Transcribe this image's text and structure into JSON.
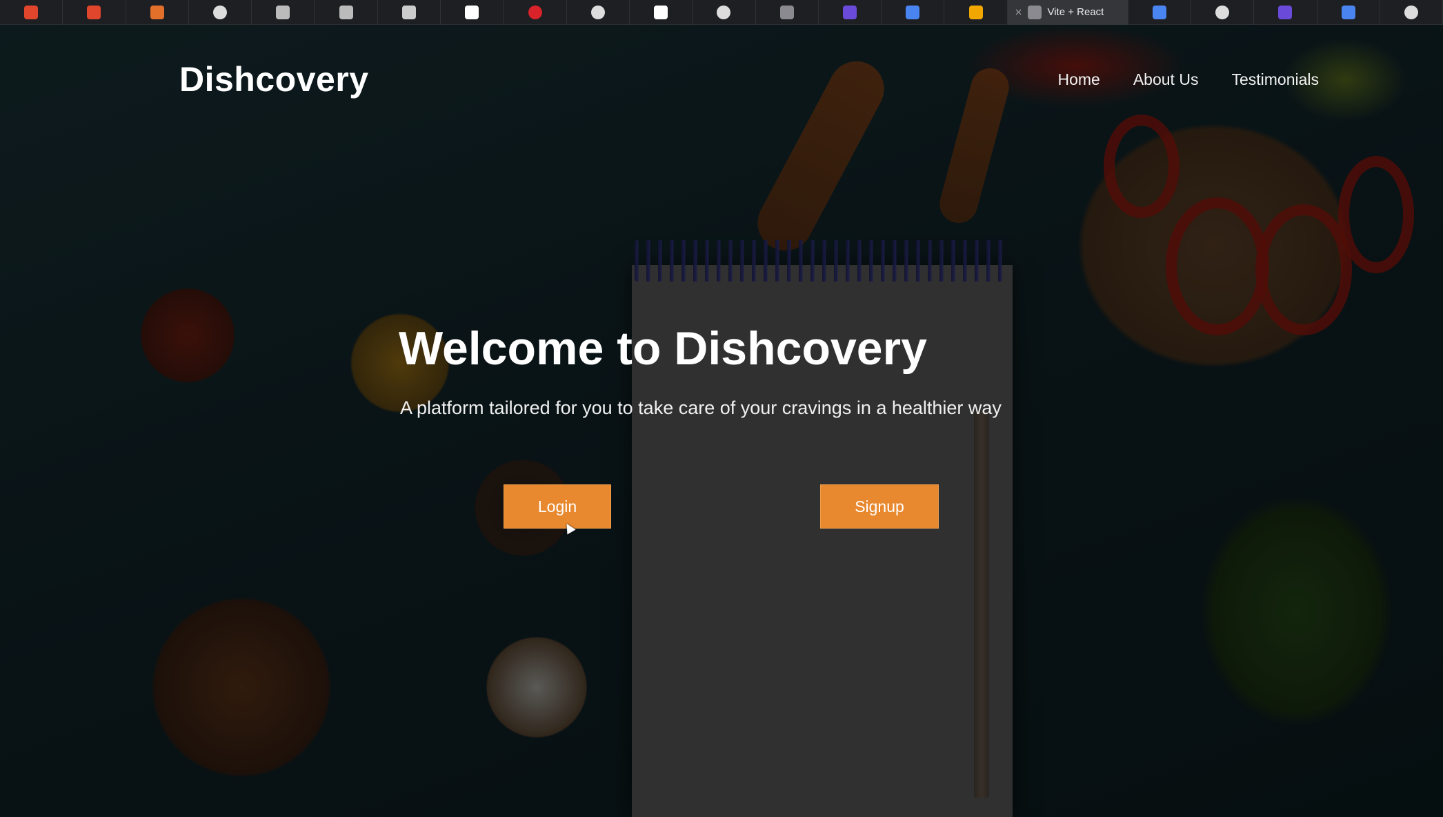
{
  "browser": {
    "tabs": [
      {
        "icon": "red-app-icon",
        "color": "#e0462c"
      },
      {
        "icon": "red-app-icon",
        "color": "#e0462c"
      },
      {
        "icon": "orange-app-icon",
        "color": "#e2702a"
      },
      {
        "icon": "chrome-icon",
        "color": "#dddddd"
      },
      {
        "icon": "github-copilot-icon",
        "color": "#bbbbbb"
      },
      {
        "icon": "github-copilot-icon",
        "color": "#bbbbbb"
      },
      {
        "icon": "openai-icon",
        "color": "#cccccc"
      },
      {
        "icon": "github-icon",
        "color": "#ffffff"
      },
      {
        "icon": "red-circle-icon",
        "color": "#d8232a"
      },
      {
        "icon": "chrome-icon",
        "color": "#dddddd"
      },
      {
        "icon": "notion-icon",
        "color": "#ffffff"
      },
      {
        "icon": "chrome-icon",
        "color": "#dddddd"
      },
      {
        "icon": "grey-app-icon",
        "color": "#8a8a90"
      },
      {
        "icon": "purple-app-icon",
        "color": "#6a4ad8"
      },
      {
        "icon": "google-docs-icon",
        "color": "#4a84f0"
      },
      {
        "icon": "google-colab-icon",
        "color": "#f2a600"
      }
    ],
    "active_tab": {
      "title": "Vite + React",
      "icon": "vite-icon",
      "close_icon": "close-icon"
    },
    "tabs_after": [
      {
        "icon": "google-docs-icon",
        "color": "#4a84f0"
      },
      {
        "icon": "chrome-icon",
        "color": "#dddddd"
      },
      {
        "icon": "purple-app-icon",
        "color": "#6a4ad8"
      },
      {
        "icon": "google-docs-icon",
        "color": "#4a84f0"
      },
      {
        "icon": "chrome-icon",
        "color": "#dddddd"
      }
    ]
  },
  "header": {
    "brand": "Dishcovery",
    "nav": [
      "Home",
      "About Us",
      "Testimonials"
    ]
  },
  "hero": {
    "title": "Welcome to Dishcovery",
    "subtitle": "A platform tailored for you to take care of your cravings in a healthier way",
    "login_label": "Login",
    "signup_label": "Signup"
  },
  "colors": {
    "accent": "#e8892f",
    "text": "#ffffff"
  }
}
